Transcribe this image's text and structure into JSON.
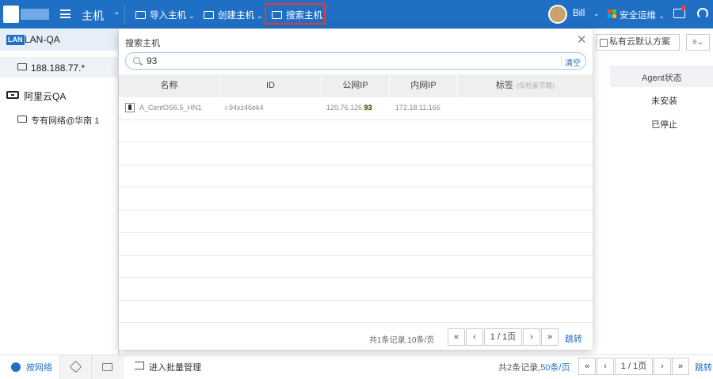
{
  "topbar": {
    "title": "主机",
    "nav": [
      {
        "label": "导入主机",
        "icon": "import-icon",
        "has_dropdown": true
      },
      {
        "label": "创建主机",
        "icon": "create-icon",
        "has_dropdown": true
      },
      {
        "label": "搜索主机",
        "icon": "search-host-icon",
        "has_dropdown": false
      }
    ],
    "user": "Bill",
    "security_ops": "安全运维",
    "colors": {
      "topbar": "#1f6fc5",
      "highlight_box": "#e53935"
    }
  },
  "sidebar": {
    "lan_badge": "LAN",
    "lan_label": "LAN-QA",
    "host_label": "188.188.77.*",
    "aliyun_label": "阿里云QA",
    "network_label": "专有网络@华南 1"
  },
  "bottombar": {
    "tab_network": "按网络",
    "batch": "进入批量管理",
    "summary_prefix": "共2条记录,",
    "summary_per_page": "50条/页",
    "page": "1 / 1页",
    "jump": "跳转"
  },
  "background": {
    "filter_label": "私有云默认方案",
    "sort_icon": "sort-icon",
    "agent_header": "Agent状态",
    "agent_rows": [
      "未安装",
      "已停止"
    ]
  },
  "modal": {
    "title": "搜索主机",
    "search_value": "93",
    "clear_label": "清空",
    "columns": [
      "名称",
      "ID",
      "公网IP",
      "内网IP",
      "标签"
    ],
    "tag_hint": "(仅检索节题)",
    "rows": [
      {
        "name": "A_CentOS6.5_HN1",
        "id": "i-94xz46ek4",
        "public_ip_prefix": "120.76.126.",
        "public_ip_match": "93",
        "private_ip": "172.18.11.166",
        "tag": ""
      }
    ],
    "footer_summary": "共1条记录,10条/页",
    "page": "1 / 1页",
    "jump": "跳转"
  }
}
